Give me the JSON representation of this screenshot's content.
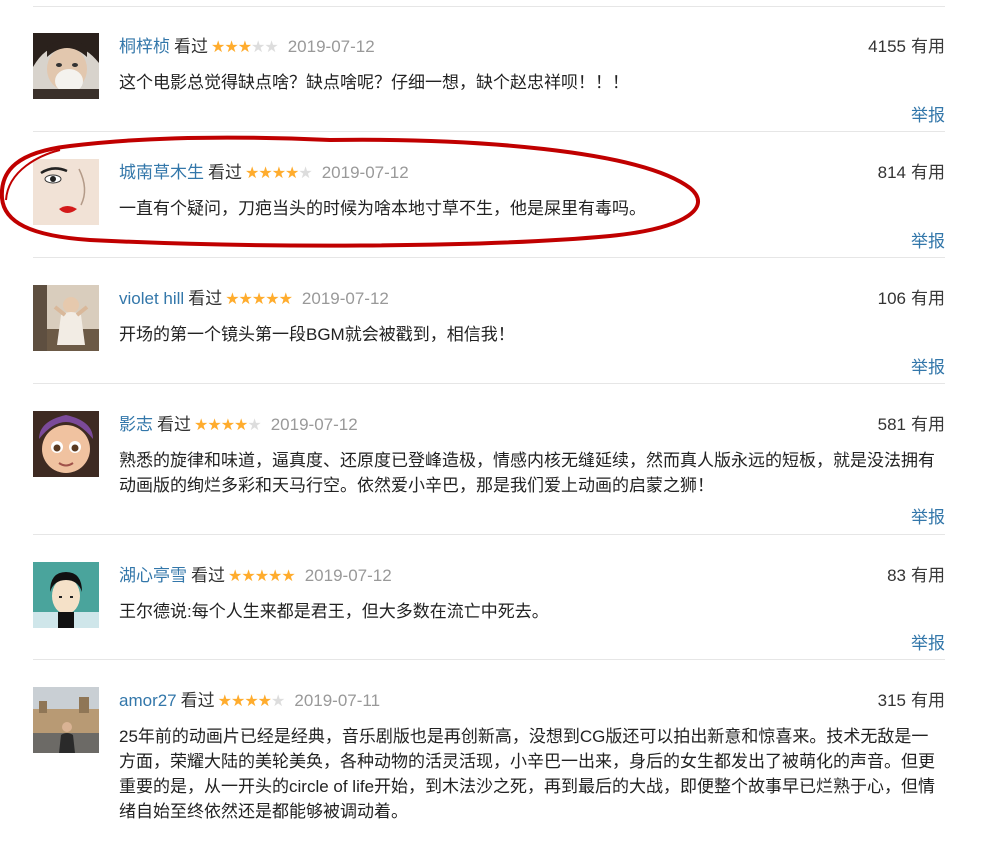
{
  "comments": [
    {
      "author": "桐梓桢",
      "status": "看过",
      "rating": 3,
      "date": "2019-07-12",
      "votes": "4155",
      "votes_label": "有用",
      "text": "这个电影总觉得缺点啥？缺点啥呢？仔细一想，缺个赵忠祥呗！！！",
      "report_label": "举报"
    },
    {
      "author": "城南草木生",
      "status": "看过",
      "rating": 4,
      "date": "2019-07-12",
      "votes": "814",
      "votes_label": "有用",
      "text": "一直有个疑问，刀疤当头的时候为啥本地寸草不生，他是屎里有毒吗。",
      "report_label": "举报"
    },
    {
      "author": "violet hill",
      "status": "看过",
      "rating": 5,
      "date": "2019-07-12",
      "votes": "106",
      "votes_label": "有用",
      "text": "开场的第一个镜头第一段BGM就会被戳到，相信我！",
      "report_label": "举报"
    },
    {
      "author": "影志",
      "status": "看过",
      "rating": 4,
      "date": "2019-07-12",
      "votes": "581",
      "votes_label": "有用",
      "text": "熟悉的旋律和味道，逼真度、还原度已登峰造极，情感内核无缝延续，然而真人版永远的短板，就是没法拥有动画版的绚烂多彩和天马行空。依然爱小辛巴，那是我们爱上动画的启蒙之狮！",
      "report_label": "举报"
    },
    {
      "author": "湖心亭雪",
      "status": "看过",
      "rating": 5,
      "date": "2019-07-12",
      "votes": "83",
      "votes_label": "有用",
      "text": "王尔德说:每个人生来都是君王，但大多数在流亡中死去。",
      "report_label": "举报"
    },
    {
      "author": "amor27",
      "status": "看过",
      "rating": 4,
      "date": "2019-07-11",
      "votes": "315",
      "votes_label": "有用",
      "text": "25年前的动画片已经是经典，音乐剧版也是再创新高，没想到CG版还可以拍出新意和惊喜来。技术无敌是一方面，荣耀大陆的美轮美奂，各种动物的活灵活现，小辛巴一出来，身后的女生都发出了被萌化的声音。但更重要的是，从一开头的circle of life开始，到木法沙之死，再到最后的大战，即便整个故事早已烂熟于心，但情绪自始至终依然还是都能够被调动着。",
      "report_label": ""
    }
  ],
  "colors": {
    "link": "#3377aa",
    "star": "#ffac2d",
    "star_empty": "#dddddd",
    "annotation": "#c00000"
  }
}
